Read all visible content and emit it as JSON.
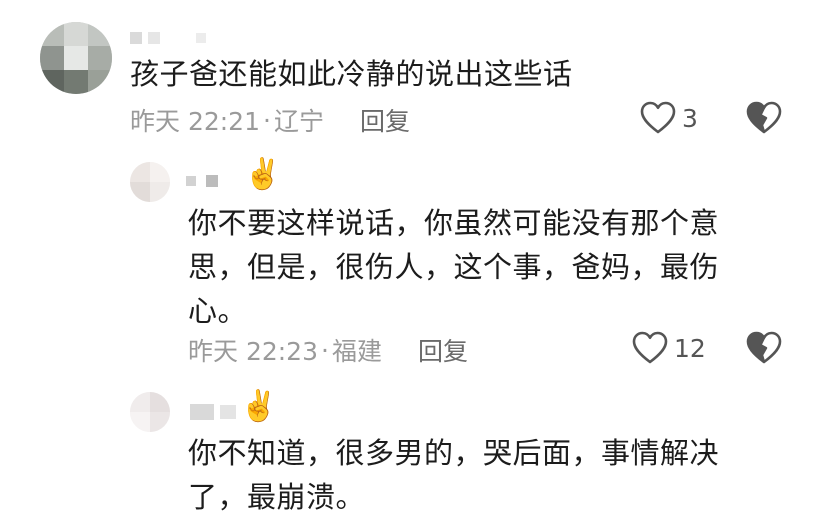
{
  "comments": [
    {
      "text": "孩子爸还能如此冷静的说出这些话",
      "time": "昨天 22:21",
      "location": "辽宁",
      "reply_label": "回复",
      "likes": "3"
    },
    {
      "text": "你不要这样说话，你虽然可能没有那个意思，但是，很伤人，这个事，爸妈，最伤心。",
      "badge": "✌️",
      "time": "昨天 22:23",
      "location": "福建",
      "reply_label": "回复",
      "likes": "12"
    },
    {
      "text": "你不知道，很多男的，哭后面，事情解决了，最崩溃。",
      "badge": "✌️"
    }
  ],
  "meta_separator": "·",
  "icons": {
    "like": "heart-outline-icon",
    "dislike": "broken-heart-icon"
  },
  "colors": {
    "text": "#1c1c1c",
    "meta": "#9a9a9a",
    "reply": "#6a6a6a",
    "icon": "#555555"
  }
}
